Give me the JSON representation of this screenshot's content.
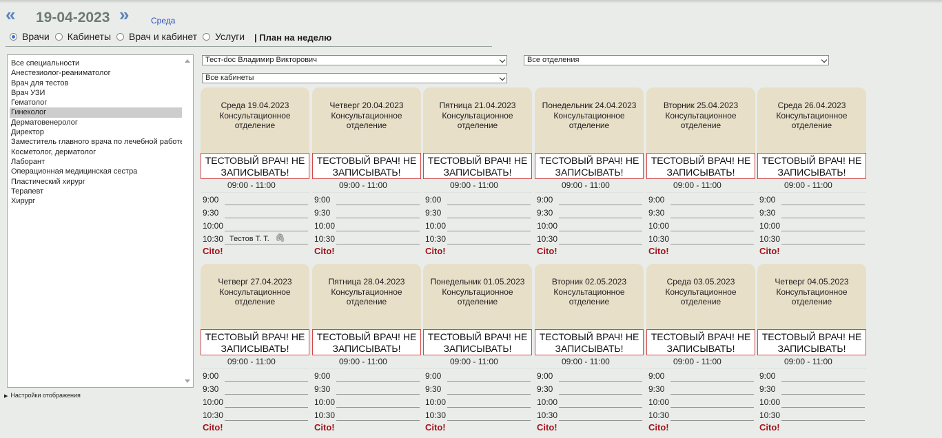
{
  "header": {
    "prev_arrow": "«",
    "next_arrow": "»",
    "date": "19-04-2023",
    "weekday": "Среда"
  },
  "modes": [
    {
      "label": "Врачи",
      "selected": true
    },
    {
      "label": "Кабинеты",
      "selected": false
    },
    {
      "label": "Врач и кабинет",
      "selected": false
    },
    {
      "label": "Услуги",
      "selected": false
    }
  ],
  "week_plan": "| План на неделю",
  "specialties": [
    "Все специальности",
    "Анестезиолог-реаниматолог",
    "Врач для тестов",
    "Врач УЗИ",
    "Гематолог",
    "Гинеколог",
    "Дерматовенеролог",
    "Директор",
    "Заместитель главного врача по лечебной работе",
    "Косметолог, дерматолог",
    "Лаборант",
    "Операционная медицинская сестра",
    "Пластический хирург",
    "Терапевт",
    "Хирург"
  ],
  "selected_specialty": "Гинеколог",
  "settings_label": "Настройки отображения",
  "filters": {
    "doctor": "Тест-doc Владимир Викторович",
    "department": "Все отделения",
    "cabinet": "Все кабинеты"
  },
  "schedule": {
    "department": [
      "Консультационное",
      "отделение"
    ],
    "doctor_note": [
      "ТЕСТОВЫЙ ВРАЧ! НЕ",
      "ЗАПИСЫВАТЬ!"
    ],
    "work_hours": "09:00 - 11:00",
    "slot_times": [
      "9:00",
      "9:30",
      "10:00",
      "10:30"
    ],
    "cito": "Cito!",
    "days": [
      {
        "date": "Среда 19.04.2023",
        "bookings": {
          "3": "Тестов Т. Т."
        }
      },
      {
        "date": "Четверг 20.04.2023",
        "bookings": {}
      },
      {
        "date": "Пятница 21.04.2023",
        "bookings": {}
      },
      {
        "date": "Понедельник 24.04.2023",
        "bookings": {}
      },
      {
        "date": "Вторник 25.04.2023",
        "bookings": {}
      },
      {
        "date": "Среда 26.04.2023",
        "bookings": {}
      },
      {
        "date": "Четверг 27.04.2023",
        "bookings": {}
      },
      {
        "date": "Пятница 28.04.2023",
        "bookings": {}
      },
      {
        "date": "Понедельник 01.05.2023",
        "bookings": {}
      },
      {
        "date": "Вторник 02.05.2023",
        "bookings": {}
      },
      {
        "date": "Среда 03.05.2023",
        "bookings": {}
      },
      {
        "date": "Четверг 04.05.2023",
        "bookings": {}
      }
    ]
  }
}
